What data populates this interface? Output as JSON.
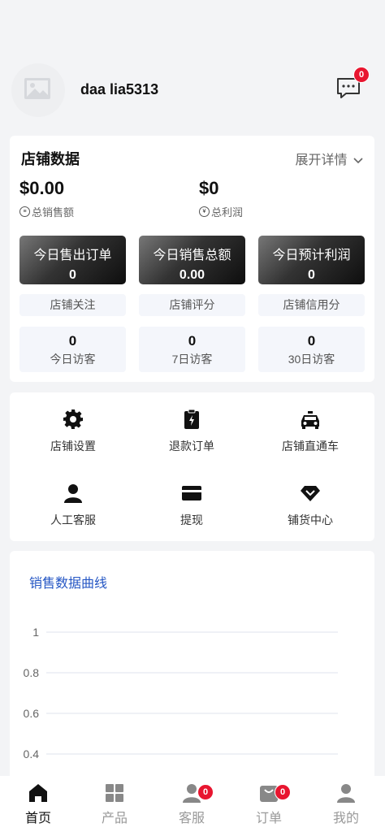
{
  "profile": {
    "username": "daa lia5313",
    "message_badge": "0"
  },
  "store": {
    "title": "店铺数据",
    "expand_label": "展开详情",
    "total_sales_value": "$0.00",
    "total_sales_label": "总销售额",
    "total_profit_value": "$0",
    "total_profit_label": "总利润",
    "today_stats": [
      {
        "label": "今日售出订单",
        "value": "0"
      },
      {
        "label": "今日销售总额",
        "value": "0.00"
      },
      {
        "label": "今日预计利润",
        "value": "0"
      }
    ],
    "tags": [
      "店铺关注",
      "店铺评分",
      "店铺信用分"
    ],
    "visitors": [
      {
        "value": "0",
        "label": "今日访客"
      },
      {
        "value": "0",
        "label": "7日访客"
      },
      {
        "value": "0",
        "label": "30日访客"
      }
    ]
  },
  "menu": [
    {
      "label": "店铺设置",
      "icon": "gear-icon"
    },
    {
      "label": "退款订单",
      "icon": "refund-clipboard-icon"
    },
    {
      "label": "店铺直通车",
      "icon": "car-icon"
    },
    {
      "label": "人工客服",
      "icon": "person-icon"
    },
    {
      "label": "提现",
      "icon": "wallet-card-icon"
    },
    {
      "label": "铺货中心",
      "icon": "diamond-icon"
    }
  ],
  "chart_data": {
    "type": "line",
    "title": "销售数据曲线",
    "yticks": [
      "1",
      "0.8",
      "0.6",
      "0.4"
    ],
    "ylim": [
      0,
      1
    ],
    "series": [],
    "grid": true
  },
  "nav": [
    {
      "label": "首页",
      "icon": "home-icon",
      "active": true,
      "badge": ""
    },
    {
      "label": "产品",
      "icon": "grid-icon",
      "active": false,
      "badge": ""
    },
    {
      "label": "客服",
      "icon": "support-person-icon",
      "active": false,
      "badge": "0"
    },
    {
      "label": "订单",
      "icon": "order-bag-icon",
      "active": false,
      "badge": "0"
    },
    {
      "label": "我的",
      "icon": "user-icon",
      "active": false,
      "badge": ""
    }
  ],
  "colors": {
    "accent_blue": "#2456c4",
    "badge_red": "#e8152f",
    "background": "#f3f4f6"
  }
}
